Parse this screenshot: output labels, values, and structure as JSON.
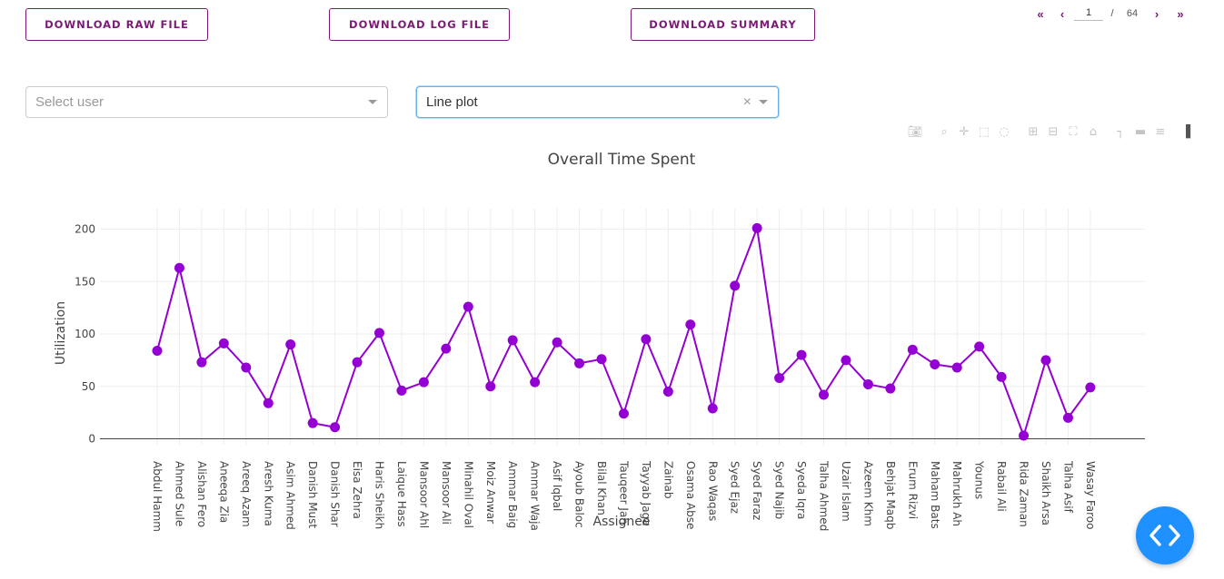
{
  "buttons": {
    "raw": "DOWNLOAD RAW FILE",
    "log": "DOWNLOAD LOG FILE",
    "summary": "DOWNLOAD SUMMARY"
  },
  "pager": {
    "first": "«",
    "prev": "‹",
    "current": "1",
    "sep": "/",
    "total": "64",
    "next": "›",
    "last": "»"
  },
  "user_select": {
    "placeholder": "Select user"
  },
  "plot_select": {
    "value": "Line plot",
    "clear": "×"
  },
  "modebar_icons": [
    "camera-icon",
    "zoom-icon",
    "pan-icon",
    "box-select-icon",
    "lasso-icon",
    "zoom-in-icon",
    "zoom-out-icon",
    "autoscale-icon",
    "reset-axes-icon",
    "spike-lines-icon",
    "hover-closest-icon",
    "hover-compare-icon",
    "plotly-logo-icon"
  ],
  "chart_data": {
    "type": "line",
    "title": "Overall Time Spent",
    "xlabel": "Assignee",
    "ylabel": "Utilization",
    "yticks": [
      0,
      50,
      100,
      150,
      200
    ],
    "ylim": [
      -3,
      215
    ],
    "grid": true,
    "color": "#9400d3",
    "categories": [
      "Abdul Hamm",
      "Ahmed Sule",
      "Alishan Fero",
      "Aneeqa Zia",
      "Areeq Azam",
      "Aresh Kuma",
      "Asim Ahmed",
      "Danish Must",
      "Danish Shar",
      "Eisa Zehra",
      "Haris Sheikh",
      "Laique Hass",
      "Mansoor Ahl",
      "Mansoor Ali",
      "Minahil Oval",
      "Moiz Anwar",
      "Ammar Baig",
      "Ammar Waja",
      "Asif Iqbal",
      "Ayoub Baloc",
      "Bilal Khan",
      "Tauqeer Jah",
      "Tayyab Jaga",
      "Zainab",
      "Osama Abse",
      "Rao Waqas",
      "Syed Ejaz",
      "Syed Faraz",
      "Syed Najib",
      "Syeda Iqra",
      "Talha Ahmed",
      "Uzair Islam",
      "Azeem Khm",
      "Behjat Maqb",
      "Erum Rizvi",
      "Maham Bats",
      "Mahrukh Ah",
      "Younus",
      "Rabail Ali",
      "Rida Zaman",
      "Shaikh Arsa",
      "Talha Asif",
      "Wasay Faroo"
    ],
    "values": [
      84,
      163,
      73,
      91,
      68,
      34,
      90,
      15,
      11,
      73,
      101,
      46,
      54,
      86,
      126,
      50,
      94,
      54,
      92,
      72,
      76,
      24,
      95,
      45,
      109,
      29,
      146,
      201,
      58,
      80,
      42,
      75,
      52,
      48,
      85,
      71,
      68,
      88,
      59,
      3,
      75,
      20,
      49
    ]
  }
}
